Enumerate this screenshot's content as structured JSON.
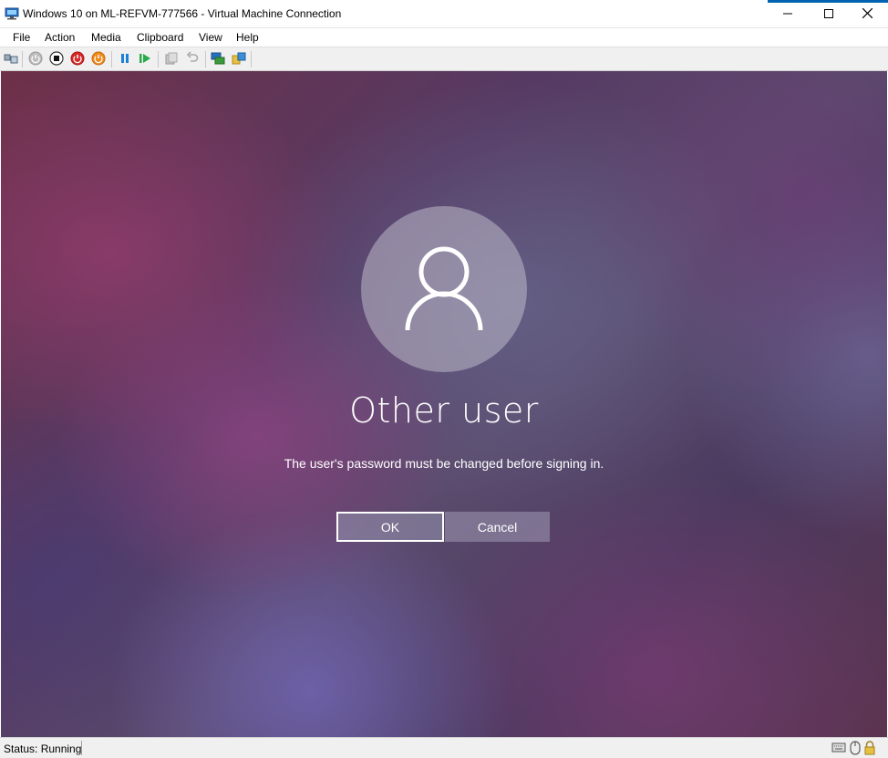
{
  "window": {
    "title": "Windows 10 on ML-REFVM-777566 - Virtual Machine Connection"
  },
  "menu": {
    "items": [
      {
        "label": "File"
      },
      {
        "label": "Action"
      },
      {
        "label": "Media"
      },
      {
        "label": "Clipboard"
      },
      {
        "label": "View"
      },
      {
        "label": "Help"
      }
    ]
  },
  "toolbar": {
    "buttons": [
      "ctrl-alt-del-icon",
      "start-icon",
      "turn-off-icon",
      "shut-down-icon",
      "save-icon",
      "pause-icon",
      "resume-icon",
      "checkpoint-icon",
      "revert-icon",
      "enhanced-session-icon",
      "share-icon"
    ]
  },
  "vm_screen": {
    "user_name": "Other user",
    "message": "The user's password must be changed before signing in.",
    "ok_label": "OK",
    "cancel_label": "Cancel"
  },
  "status": {
    "text": "Status: Running"
  },
  "colors": {
    "titlebar_bg": "#ffffff",
    "toolbar_bg": "#f0f0f0",
    "accent": "#0063b1"
  }
}
